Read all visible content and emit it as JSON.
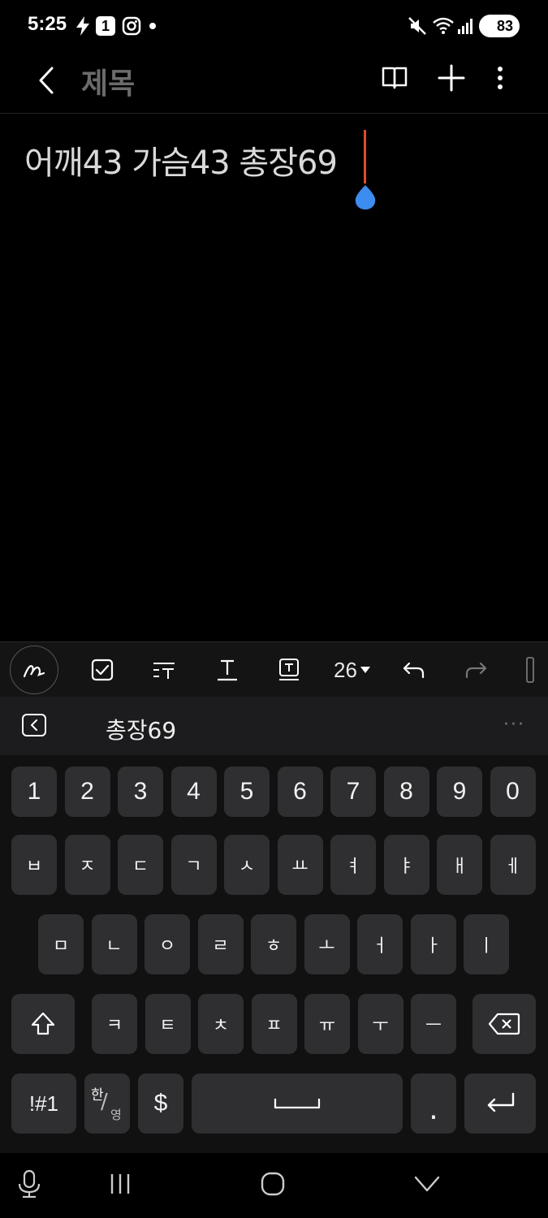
{
  "status_bar": {
    "time": "5:25",
    "badge": "1",
    "battery": "83"
  },
  "appbar": {
    "title": "제목"
  },
  "note": {
    "text": "어깨43 가슴43 총장69"
  },
  "toolbar": {
    "font_size": "26"
  },
  "suggestion": {
    "word": "총장69",
    "more": "···"
  },
  "keyboard": {
    "row_numbers": [
      "1",
      "2",
      "3",
      "4",
      "5",
      "6",
      "7",
      "8",
      "9",
      "0"
    ],
    "row1": [
      "ㅂ",
      "ㅈ",
      "ㄷ",
      "ㄱ",
      "ㅅ",
      "ㅛ",
      "ㅕ",
      "ㅑ",
      "ㅐ",
      "ㅔ"
    ],
    "row2": [
      "ㅁ",
      "ㄴ",
      "ㅇ",
      "ㄹ",
      "ㅎ",
      "ㅗ",
      "ㅓ",
      "ㅏ",
      "ㅣ"
    ],
    "row3": [
      "ㅋ",
      "ㅌ",
      "ㅊ",
      "ㅍ",
      "ㅠ",
      "ㅜ",
      "ㅡ"
    ],
    "symbols_label": "!#1",
    "lang_top": "한",
    "lang_bottom": "영",
    "currency_label": "$",
    "period_label": "."
  },
  "colors": {
    "cursor": "#e34a2c",
    "handle": "#3d8cf0",
    "title_gray": "#6b6b6b",
    "key_bg": "#2f2f31"
  }
}
